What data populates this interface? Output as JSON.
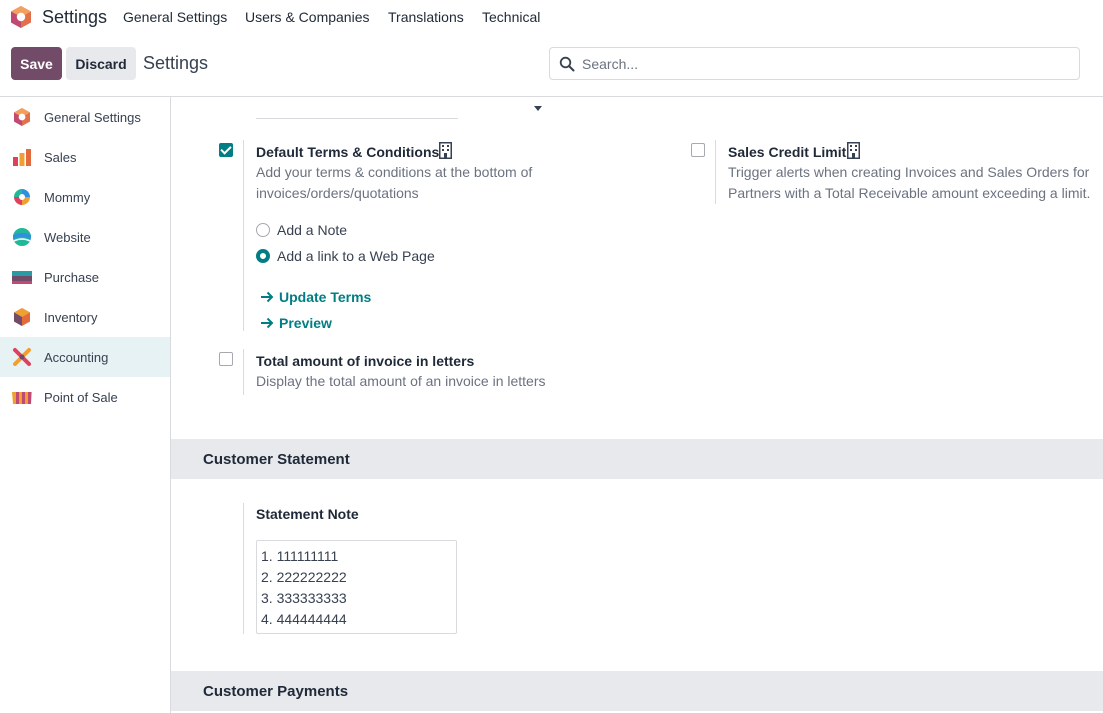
{
  "topbar": {
    "app_title": "Settings",
    "menu": [
      "General Settings",
      "Users & Companies",
      "Translations",
      "Technical"
    ]
  },
  "control": {
    "save_label": "Save",
    "discard_label": "Discard",
    "title": "Settings",
    "search_placeholder": "Search...",
    "search_value": ""
  },
  "sidebar": {
    "items": [
      {
        "label": "General Settings",
        "icon": "odoo-logo-icon"
      },
      {
        "label": "Sales",
        "icon": "sales-icon"
      },
      {
        "label": "Mommy",
        "icon": "mommy-app-icon"
      },
      {
        "label": "Website",
        "icon": "website-icon"
      },
      {
        "label": "Purchase",
        "icon": "purchase-icon"
      },
      {
        "label": "Inventory",
        "icon": "inventory-icon"
      },
      {
        "label": "Accounting",
        "icon": "accounting-icon",
        "active": true
      },
      {
        "label": "Point of Sale",
        "icon": "point-of-sale-icon"
      }
    ]
  },
  "settings": {
    "default_terms": {
      "title": "Default Terms & Conditions",
      "checked": true,
      "desc": "Add your terms & conditions at the bottom of invoices/orders/quotations",
      "options": [
        {
          "label": "Add a Note",
          "selected": false
        },
        {
          "label": "Add a link to a Web Page",
          "selected": true
        }
      ],
      "links": [
        "Update Terms",
        "Preview"
      ]
    },
    "credit_limit": {
      "title": "Sales Credit Limit",
      "checked": false,
      "desc": "Trigger alerts when creating Invoices and Sales Orders for Partners with a Total Receivable amount exceeding a limit."
    },
    "amount_letters": {
      "title": "Total amount of invoice in letters",
      "checked": false,
      "desc": "Display the total amount of an invoice in letters"
    }
  },
  "sections": {
    "customer_statement": "Customer Statement",
    "customer_payments": "Customer Payments"
  },
  "statement": {
    "label": "Statement Note",
    "lines": [
      "1. 111111111",
      "2. 222222222",
      "3. 333333333",
      "4. 444444444"
    ]
  },
  "colors": {
    "brand": "#714b67",
    "accent": "#017e84",
    "active_bg": "#e6f2f3",
    "section_bg": "#e7e9ed"
  }
}
